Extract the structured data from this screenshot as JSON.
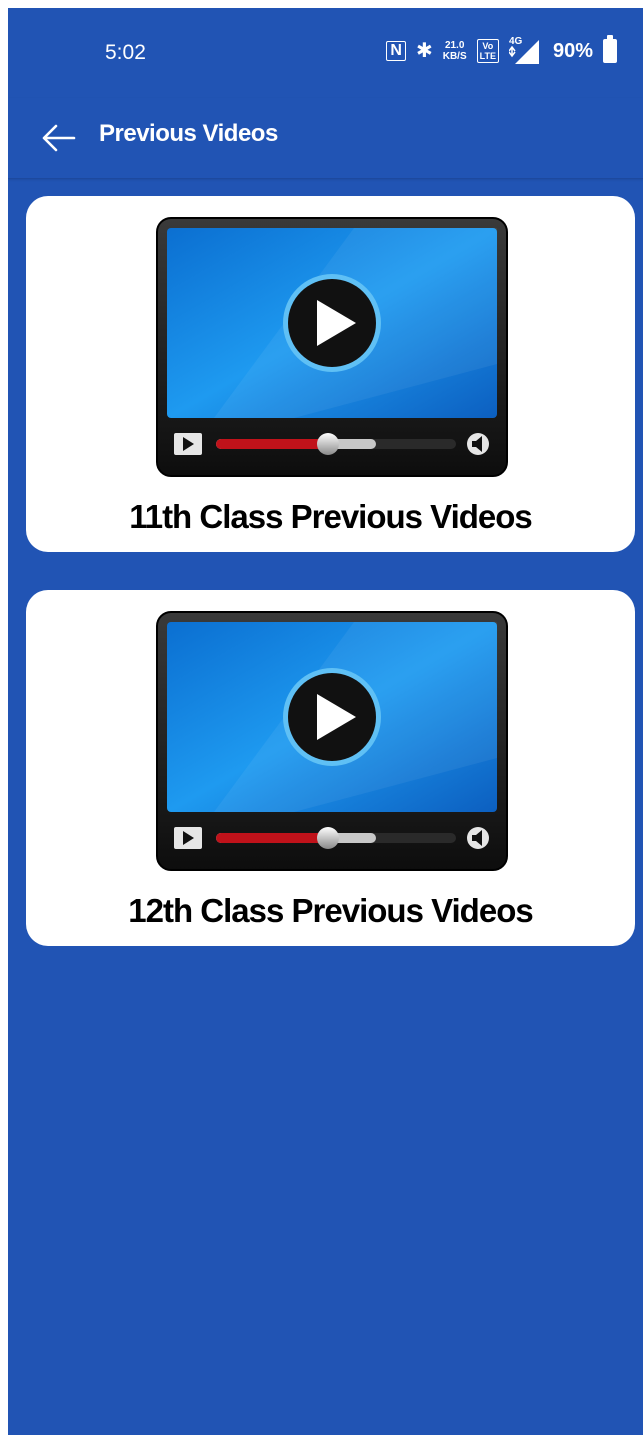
{
  "status_bar": {
    "time": "5:02",
    "nfc": "N",
    "bluetooth": "✱",
    "speed_value": "21.0",
    "speed_unit": "KB/S",
    "volte_top": "Vo",
    "volte_bottom": "LTE",
    "network": "4G",
    "battery_percent": "90%"
  },
  "app_bar": {
    "back_icon": "back-arrow-icon",
    "title": "Previous Videos"
  },
  "cards": [
    {
      "label": "11th Class Previous Videos",
      "icon": "video-player-icon"
    },
    {
      "label": "12th Class Previous Videos",
      "icon": "video-player-icon"
    }
  ],
  "colors": {
    "background": "#2154b4",
    "card": "#ffffff",
    "text": "#000000"
  }
}
